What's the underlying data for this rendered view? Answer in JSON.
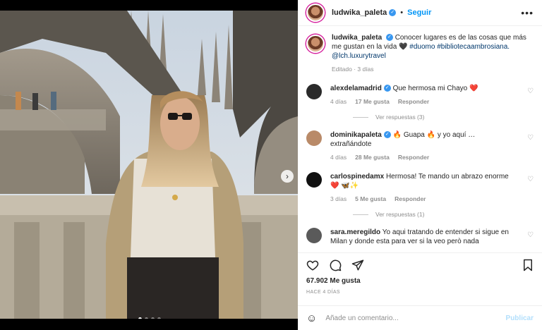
{
  "post": {
    "username": "ludwika_paleta",
    "follow_label": "Seguir",
    "more_label": "•••",
    "caption_user": "ludwika_paleta",
    "caption_text": "Conocer lugares es de las cosas que más me gustan en la vida 🖤 ",
    "caption_tags": "#duomo #bibliotecaambrosiana.",
    "caption_mention": "@lch.luxurytravel",
    "caption_meta": "Editado · 3 días"
  },
  "comments": [
    {
      "user": "alexdelamadrid",
      "verified": true,
      "text": "Que hermosa mi Chayo ❤️",
      "time": "4 días",
      "likes": "17 Me gusta",
      "reply": "Responder",
      "avatar_color": "#2a2a2a",
      "replies_label": "Ver respuestas (3)"
    },
    {
      "user": "dominikapaleta",
      "verified": true,
      "text": "🔥 Guapa 🔥 y yo aquí … extrañándote",
      "time": "4 días",
      "likes": "28 Me gusta",
      "reply": "Responder",
      "avatar_color": "#b98a68",
      "replies_label": ""
    },
    {
      "user": "carlospinedamx",
      "verified": false,
      "text": "Hermosa! Te mando un abrazo enorme ❤️ 🦋✨",
      "time": "3 días",
      "likes": "5 Me gusta",
      "reply": "Responder",
      "avatar_color": "#111111",
      "replies_label": "Ver respuestas (1)"
    },
    {
      "user": "sara.meregildo",
      "verified": false,
      "text": "Yo aqui tratando de entender si sigue en Milan y donde esta para ver si la veo però nada",
      "time": "",
      "likes": "",
      "reply": "",
      "avatar_color": "#5a5a5a",
      "replies_label": ""
    }
  ],
  "actions": {
    "icons": [
      "heart-icon",
      "comment-icon",
      "share-icon",
      "bookmark-icon"
    ]
  },
  "likes_count": "67.902 Me gusta",
  "posted_ago": "HACE 4 DÍAS",
  "add_comment": {
    "placeholder": "Añade un comentario...",
    "publish_label": "Publicar"
  },
  "carousel": {
    "dots": 4,
    "active": 0
  }
}
